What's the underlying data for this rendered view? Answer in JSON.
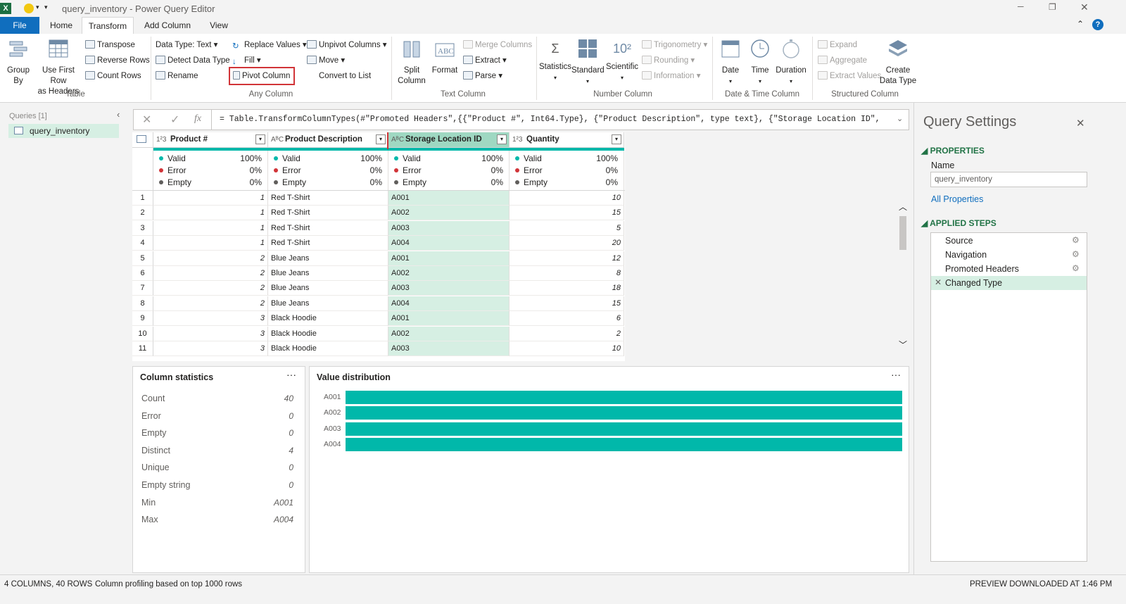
{
  "window": {
    "title": "query_inventory - Power Query Editor"
  },
  "tabs": [
    {
      "label": "File"
    },
    {
      "label": "Home"
    },
    {
      "label": "Transform"
    },
    {
      "label": "Add Column"
    },
    {
      "label": "View"
    }
  ],
  "ribbon": {
    "table": {
      "group": "Table",
      "group_by": "Group\nBy",
      "use_first_row": "Use First Row\nas Headers",
      "transpose": "Transpose",
      "reverse_rows": "Reverse Rows",
      "count_rows": "Count Rows"
    },
    "any_column": {
      "group": "Any Column",
      "data_type": "Data Type: Text",
      "detect_data_type": "Detect Data Type",
      "rename": "Rename",
      "replace_values": "Replace Values",
      "fill": "Fill",
      "pivot_column": "Pivot Column",
      "unpivot_columns": "Unpivot Columns",
      "move": "Move",
      "convert_to_list": "Convert to List"
    },
    "text_column": {
      "group": "Text Column",
      "split_column": "Split\nColumn",
      "format": "Format",
      "merge_columns": "Merge Columns",
      "extract": "Extract",
      "parse": "Parse"
    },
    "number_column": {
      "group": "Number Column",
      "statistics": "Statistics",
      "standard": "Standard",
      "scientific": "Scientific",
      "trigonometry": "Trigonometry",
      "rounding": "Rounding",
      "information": "Information"
    },
    "date_time": {
      "group": "Date & Time Column",
      "date": "Date",
      "time": "Time",
      "duration": "Duration"
    },
    "structured": {
      "group": "Structured Column",
      "expand": "Expand",
      "aggregate": "Aggregate",
      "extract_values": "Extract Values",
      "create_data_type": "Create\nData Type"
    }
  },
  "queries": {
    "header": "Queries [1]",
    "items": [
      {
        "label": "query_inventory"
      }
    ]
  },
  "formula": {
    "text": "= Table.TransformColumnTypes(#\"Promoted Headers\",{{\"Product #\", Int64.Type}, {\"Product Description\", type text}, {\"Storage Location ID\","
  },
  "columns": [
    {
      "type": "1²3",
      "name": "Product #",
      "valid": "100%",
      "error": "0%",
      "empty": "0%"
    },
    {
      "type": "AᴮC",
      "name": "Product Description",
      "valid": "100%",
      "error": "0%",
      "empty": "0%"
    },
    {
      "type": "AᴮC",
      "name": "Storage Location ID",
      "valid": "100%",
      "error": "0%",
      "empty": "0%"
    },
    {
      "type": "1²3",
      "name": "Quantity",
      "valid": "100%",
      "error": "0%",
      "empty": "0%"
    }
  ],
  "quality_labels": {
    "valid": "Valid",
    "error": "Error",
    "empty": "Empty"
  },
  "rows": [
    [
      "1",
      "1",
      "Red T-Shirt",
      "A001",
      "10"
    ],
    [
      "2",
      "1",
      "Red T-Shirt",
      "A002",
      "15"
    ],
    [
      "3",
      "1",
      "Red T-Shirt",
      "A003",
      "5"
    ],
    [
      "4",
      "1",
      "Red T-Shirt",
      "A004",
      "20"
    ],
    [
      "5",
      "2",
      "Blue Jeans",
      "A001",
      "12"
    ],
    [
      "6",
      "2",
      "Blue Jeans",
      "A002",
      "8"
    ],
    [
      "7",
      "2",
      "Blue Jeans",
      "A003",
      "18"
    ],
    [
      "8",
      "2",
      "Blue Jeans",
      "A004",
      "15"
    ],
    [
      "9",
      "3",
      "Black Hoodie",
      "A001",
      "6"
    ],
    [
      "10",
      "3",
      "Black Hoodie",
      "A002",
      "2"
    ],
    [
      "11",
      "3",
      "Black Hoodie",
      "A003",
      "10"
    ]
  ],
  "column_statistics": {
    "title": "Column statistics",
    "items": [
      {
        "label": "Count",
        "value": "40"
      },
      {
        "label": "Error",
        "value": "0"
      },
      {
        "label": "Empty",
        "value": "0"
      },
      {
        "label": "Distinct",
        "value": "4"
      },
      {
        "label": "Unique",
        "value": "0"
      },
      {
        "label": "Empty string",
        "value": "0"
      },
      {
        "label": "Min",
        "value": "A001"
      },
      {
        "label": "Max",
        "value": "A004"
      }
    ]
  },
  "value_distribution": {
    "title": "Value distribution",
    "bar_color": "#01b8aa",
    "bars": [
      {
        "label": "A001",
        "value": 10
      },
      {
        "label": "A002",
        "value": 10
      },
      {
        "label": "A003",
        "value": 10
      },
      {
        "label": "A004",
        "value": 10
      }
    ]
  },
  "settings": {
    "title": "Query Settings",
    "properties_header": "PROPERTIES",
    "name_label": "Name",
    "name_value": "query_inventory",
    "all_properties": "All Properties",
    "applied_steps_header": "APPLIED STEPS",
    "steps": [
      {
        "label": "Source"
      },
      {
        "label": "Navigation"
      },
      {
        "label": "Promoted Headers"
      },
      {
        "label": "Changed Type"
      }
    ]
  },
  "status": {
    "left": "4 COLUMNS, 40 ROWS",
    "profiling": "Column profiling based on top 1000 rows",
    "right": "PREVIEW DOWNLOADED AT 1:46 PM"
  },
  "colors": {
    "accent": "#106ebe",
    "teal": "#01b8aa",
    "error": "#d13438",
    "selected_header": "#9fd8c2",
    "selected_col": "#d6efe3"
  }
}
